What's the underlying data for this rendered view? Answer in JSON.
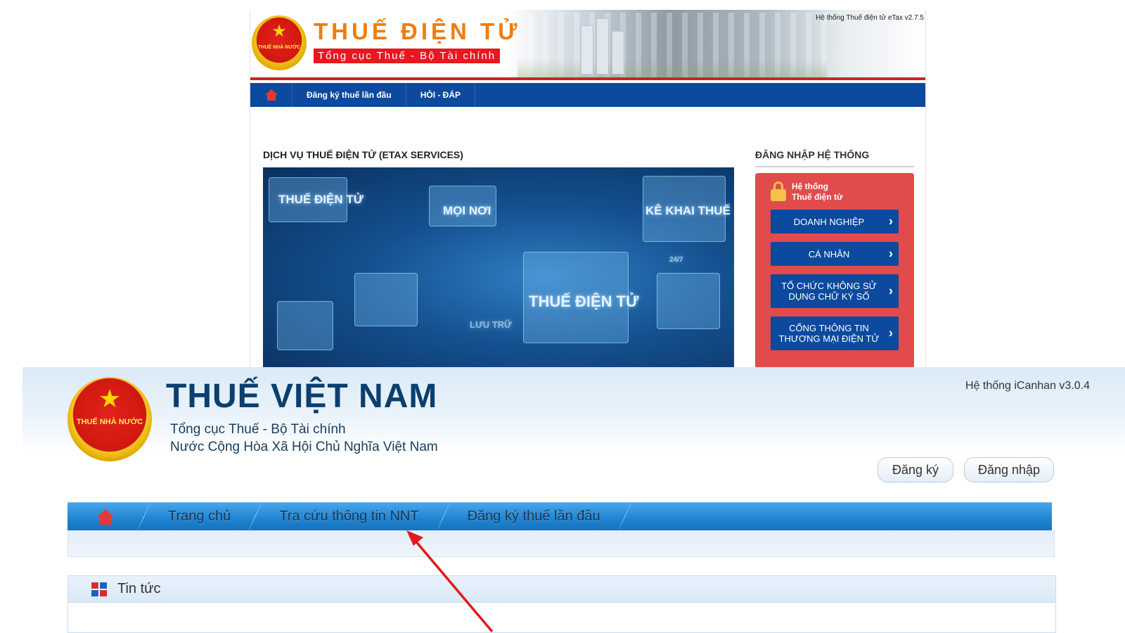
{
  "etax": {
    "brand_title": "THUẾ ĐIỆN TỬ",
    "brand_subtitle": "Tổng cục Thuế - Bộ Tài chính",
    "emblem_text": "THUẾ NHÀ NƯỚC",
    "version": "Hệ thống Thuế điện tử eTax v2.7.5",
    "nav": {
      "home_icon": "home-icon",
      "items": [
        "Đăng ký thuế lần đầu",
        "HỎI - ĐÁP"
      ]
    },
    "services_title": "DỊCH VỤ THUẾ ĐIỆN TỬ (ETAX SERVICES)",
    "hero_texts": [
      "THUẾ ĐIỆN TỬ",
      "MỌI NƠI",
      "KÊ KHAI THUẾ",
      "THUẾ ĐIỆN TỬ",
      "LƯU TRỮ",
      "24/7"
    ],
    "login": {
      "title": "ĐĂNG NHẬP HỆ THỐNG",
      "system_label": "Hệ thống\nThuế điện tử",
      "buttons": [
        "DOANH NGHIỆP",
        "CÁ NHÂN",
        "TỔ CHỨC KHÔNG SỬ DỤNG CHỮ KÝ SỐ",
        "CỔNG THÔNG TIN THƯƠNG MẠI ĐIỆN TỬ"
      ]
    }
  },
  "icanhan": {
    "title": "THUẾ VIỆT NAM",
    "subtitle1": "Tổng cục Thuế - Bộ Tài chính",
    "subtitle2": "Nước Cộng Hòa Xã Hội Chủ Nghĩa Việt Nam",
    "emblem_text": "THUẾ NHÀ NƯỚC",
    "version": "Hệ thống iCanhan v3.0.4",
    "register_button": "Đăng ký",
    "login_button": "Đăng nhập",
    "nav": {
      "home_icon": "home-icon",
      "items": [
        "Trang chủ",
        "Tra cứu thông tin NNT",
        "Đăng ký thuế lần đầu"
      ]
    },
    "news_title": "Tin tức"
  },
  "colors": {
    "etax_nav": "#0b4a9e",
    "etax_brand": "#f07d10",
    "etax_red": "#e7181f",
    "login_box": "#e14b4b",
    "icanhan_title": "#0b3f6e",
    "icanhan_nav": "#1e84d2",
    "annotation_arrow": "#e11b1b"
  }
}
